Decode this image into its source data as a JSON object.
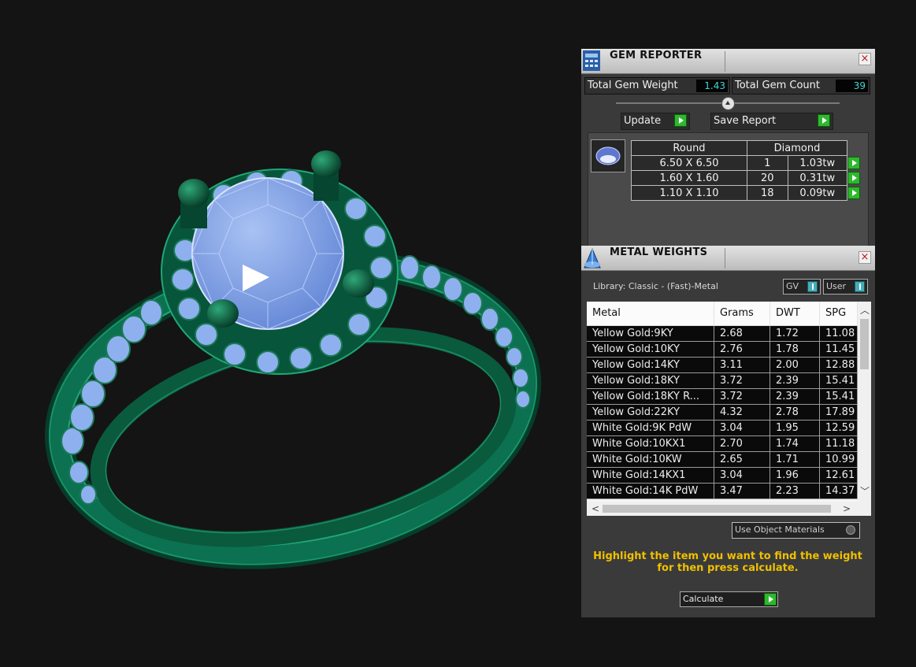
{
  "gem_reporter": {
    "title": "GEM REPORTER",
    "close_glyph": "×",
    "total_weight_label": "Total Gem Weight",
    "total_weight_value": "1.43",
    "total_count_label": "Total Gem Count",
    "total_count_value": "39",
    "update_label": "Update",
    "save_report_label": "Save Report",
    "table": {
      "shape": "Round",
      "material": "Diamond",
      "rows": [
        {
          "size": "6.50 X 6.50",
          "count": "1",
          "weight": "1.03tw"
        },
        {
          "size": "1.60 X 1.60",
          "count": "20",
          "weight": "0.31tw"
        },
        {
          "size": "1.10 X 1.10",
          "count": "18",
          "weight": "0.09tw"
        }
      ]
    }
  },
  "metal_weights": {
    "title": "METAL WEIGHTS",
    "close_glyph": "×",
    "library_label": "Library: Classic - (Fast)-Metal",
    "gv_label": "GV",
    "user_label": "User",
    "columns": [
      "Metal",
      "Grams",
      "DWT",
      "SPG"
    ],
    "rows": [
      [
        "Yellow Gold:9KY",
        "2.68",
        "1.72",
        "11.08"
      ],
      [
        "Yellow Gold:10KY",
        "2.76",
        "1.78",
        "11.45"
      ],
      [
        "Yellow Gold:14KY",
        "3.11",
        "2.00",
        "12.88"
      ],
      [
        "Yellow Gold:18KY",
        "3.72",
        "2.39",
        "15.41"
      ],
      [
        "Yellow Gold:18KY R...",
        "3.72",
        "2.39",
        "15.41"
      ],
      [
        "Yellow Gold:22KY",
        "4.32",
        "2.78",
        "17.89"
      ],
      [
        "White Gold:9K PdW",
        "3.04",
        "1.95",
        "12.59"
      ],
      [
        "White Gold:10KX1",
        "2.70",
        "1.74",
        "11.18"
      ],
      [
        "White Gold:10KW",
        "2.65",
        "1.71",
        "10.99"
      ],
      [
        "White Gold:14KX1",
        "3.04",
        "1.96",
        "12.61"
      ],
      [
        "White Gold:14K PdW",
        "3.47",
        "2.23",
        "14.37"
      ]
    ],
    "use_object_materials_label": "Use Object Materials",
    "instruction_line1": "Highlight the item you want to find the weight",
    "instruction_line2": "for then press calculate.",
    "calculate_label": "Calculate"
  },
  "colors": {
    "metal_green": "#0b6b4d",
    "gem_blue": "#7fa2ea",
    "value_cyan": "#3fd6d6",
    "instruction_yellow": "#f0c000"
  }
}
